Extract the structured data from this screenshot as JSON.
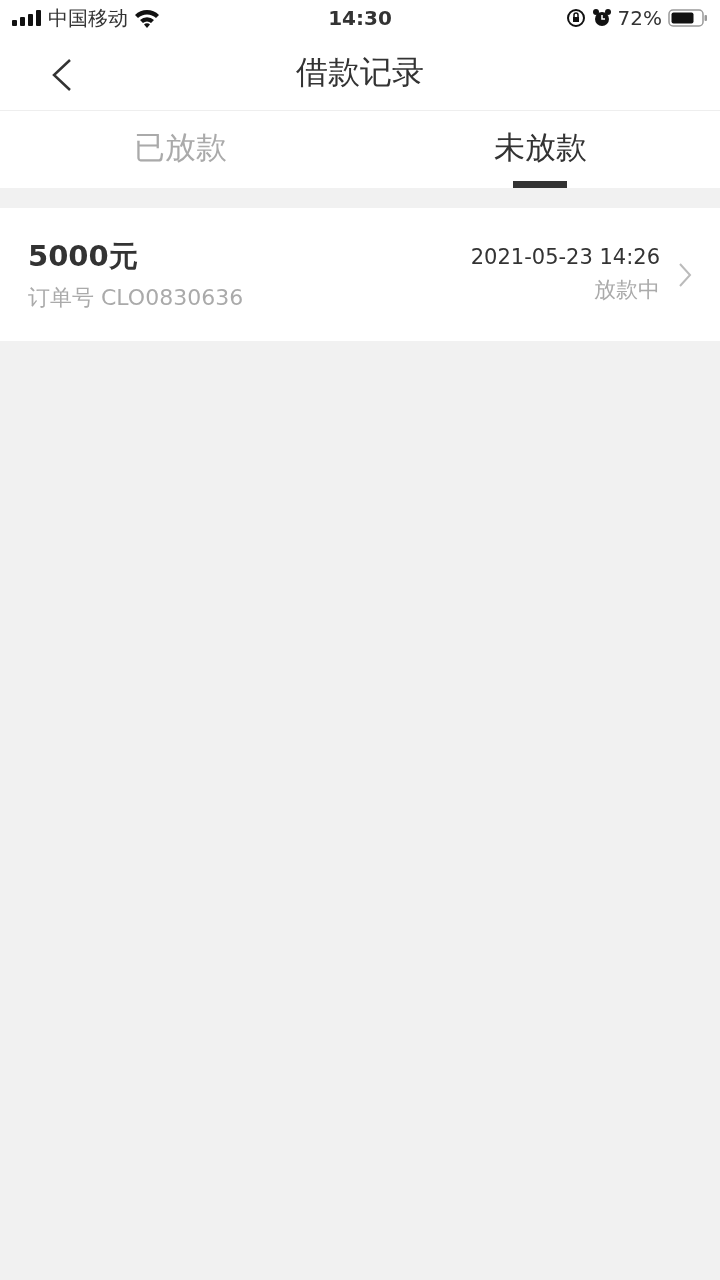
{
  "status_bar": {
    "carrier": "中国移动",
    "time": "14:30",
    "battery": "72%"
  },
  "header": {
    "title": "借款记录"
  },
  "tabs": [
    {
      "label": "已放款",
      "selected": false
    },
    {
      "label": "未放款",
      "selected": true
    }
  ],
  "records": [
    {
      "amount": "5000元",
      "order": "订单号 CLO0830636",
      "datetime": "2021-05-23 14:26",
      "status": "放款中"
    }
  ]
}
